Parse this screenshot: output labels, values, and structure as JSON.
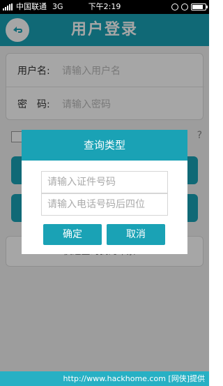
{
  "statusbar": {
    "carrier": "中国联通",
    "network": "3G",
    "time": "下午2:19",
    "battery_level": 0.85
  },
  "header": {
    "title": "用户登录",
    "back_icon": "back-arrow-icon"
  },
  "form": {
    "username_label": "用户名:",
    "username_placeholder": "请输入用户名",
    "password_label": "密　码:",
    "password_placeholder": "请输入密码",
    "forgot_hint": "?"
  },
  "link_text": "快速查询我的车票 ➜",
  "dialog": {
    "title": "查询类型",
    "id_placeholder": "请输入证件号码",
    "phone_placeholder": "请输入电话号码后四位",
    "ok_label": "确定",
    "cancel_label": "取消"
  },
  "watermark": "http://www.hackhome.com [网侠]提供",
  "colors": {
    "accent": "#1aa2b5"
  }
}
